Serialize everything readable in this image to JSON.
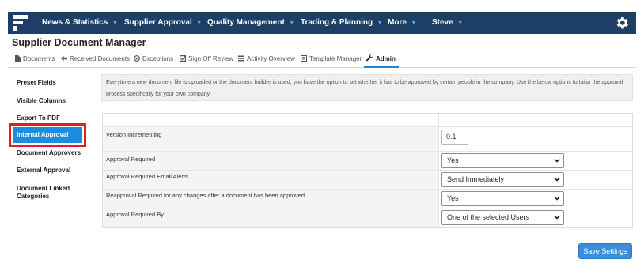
{
  "nav": {
    "items": [
      {
        "label": "News & Statistics",
        "caret": "▼"
      },
      {
        "label": "Supplier Approval",
        "caret": "▼"
      },
      {
        "label": "Quality Management",
        "caret": "▼"
      },
      {
        "label": "Trading & Planning",
        "caret": "▼"
      },
      {
        "label": "More",
        "caret": "▼"
      },
      {
        "label": "Steve",
        "caret": "▼"
      }
    ],
    "icons": {
      "logo": "logo-icon",
      "settings": "gear-icon"
    },
    "background": "#1d3f66"
  },
  "page": {
    "title": "Supplier Document Manager"
  },
  "tabs": [
    {
      "label": "Documents",
      "icon": "document-icon"
    },
    {
      "label": "Received Documents",
      "icon": "arrow-left-icon"
    },
    {
      "label": "Exceptions",
      "icon": "alert-circle-icon"
    },
    {
      "label": "Sign Off Review",
      "icon": "check-square-icon"
    },
    {
      "label": "Activity Overview",
      "icon": "list-icon"
    },
    {
      "label": "Template Manager",
      "icon": "template-icon"
    },
    {
      "label": "Admin",
      "icon": "wrench-icon",
      "active": true
    }
  ],
  "sidebar": {
    "items": [
      {
        "label": "Preset Fields"
      },
      {
        "label": "Visible Columns"
      },
      {
        "label": "Export To PDF"
      },
      {
        "label": "Internal Approval",
        "active": true
      },
      {
        "label": "Document Approvers"
      },
      {
        "label": "External Approval"
      },
      {
        "label": "Document Linked Categories"
      }
    ],
    "highlight_color": "#e31b23",
    "active_color": "#1a8dde"
  },
  "info": {
    "text": "Everytime a new document file is uploaded or the document builder is used, you have the option to set whether it has to be approved by certain people in the company. Use the below options to tailor the approval process specifically for your own company."
  },
  "settings": {
    "rows": [
      {
        "label": "Version Incrementing",
        "control": "input",
        "value": "0.1"
      },
      {
        "label": "Approval Required",
        "control": "select",
        "value": "Yes"
      },
      {
        "label": "Approval Required Email Alerts",
        "control": "select",
        "value": "Send Immediately"
      },
      {
        "label": "Reapproval Required for any changes after a document has been approved",
        "control": "select",
        "value": "Yes"
      },
      {
        "label": "Approval Required By",
        "control": "select",
        "value": "One of the selected Users"
      }
    ]
  },
  "actions": {
    "save_label": "Save Settings",
    "save_color": "#3a8fdc"
  }
}
